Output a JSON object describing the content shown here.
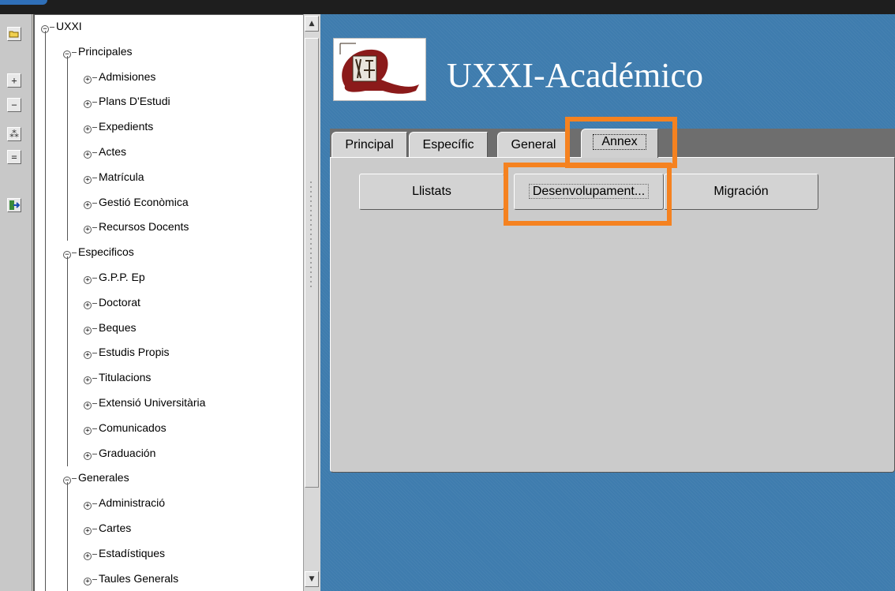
{
  "app": {
    "title": "UXXI-Académico",
    "logo_icon": "uxxi-university-logo"
  },
  "toolbar": {
    "buttons": [
      {
        "name": "open-folder-icon",
        "glyph": "▭"
      },
      {
        "name": "expand-icon",
        "glyph": "+"
      },
      {
        "name": "collapse-icon",
        "glyph": "−"
      },
      {
        "name": "expand-all-icon",
        "glyph": "⁂"
      },
      {
        "name": "collapse-all-icon",
        "glyph": "="
      },
      {
        "name": "exit-icon",
        "glyph": "⇥"
      }
    ]
  },
  "tree": {
    "root": "UXXI",
    "groups": [
      {
        "label": "Principales",
        "items": [
          "Admisiones",
          "Plans D'Estudi",
          "Expedients",
          "Actes",
          "Matrícula",
          "Gestió Econòmica",
          "Recursos Docents"
        ]
      },
      {
        "label": "Especificos",
        "items": [
          "G.P.P. Ep",
          "Doctorat",
          "Beques",
          "Estudis Propis",
          "Titulacions",
          "Extensió Universitària",
          "Comunicados",
          "Graduación"
        ]
      },
      {
        "label": "Generales",
        "items": [
          "Administració",
          "Cartes",
          "Estadístiques",
          "Taules Generals"
        ]
      }
    ]
  },
  "tabs": [
    "Principal",
    "Específic",
    "General",
    "Annex"
  ],
  "active_tab": "Annex",
  "panel_buttons": [
    "Llistats",
    "Desenvolupament...",
    "Migración"
  ],
  "colors": {
    "main_background": "#3e7cae",
    "highlight": "#f58220",
    "logo_red": "#8b1a1a"
  }
}
